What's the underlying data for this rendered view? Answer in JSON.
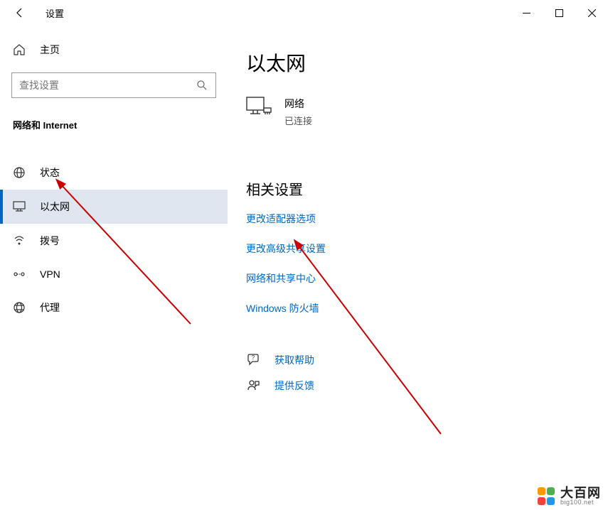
{
  "window": {
    "title": "设置"
  },
  "sidebar": {
    "home": "主页",
    "search_placeholder": "查找设置",
    "category": "网络和 Internet",
    "items": [
      {
        "label": "状态"
      },
      {
        "label": "以太网"
      },
      {
        "label": "拨号"
      },
      {
        "label": "VPN"
      },
      {
        "label": "代理"
      }
    ]
  },
  "content": {
    "title": "以太网",
    "network": {
      "name": "网络",
      "status": "已连接"
    },
    "related_title": "相关设置",
    "links": [
      "更改适配器选项",
      "更改高级共享设置",
      "网络和共享中心",
      "Windows 防火墙"
    ],
    "help": [
      "获取帮助",
      "提供反馈"
    ]
  },
  "watermark": {
    "name": "大百网",
    "url": "big100.net"
  }
}
